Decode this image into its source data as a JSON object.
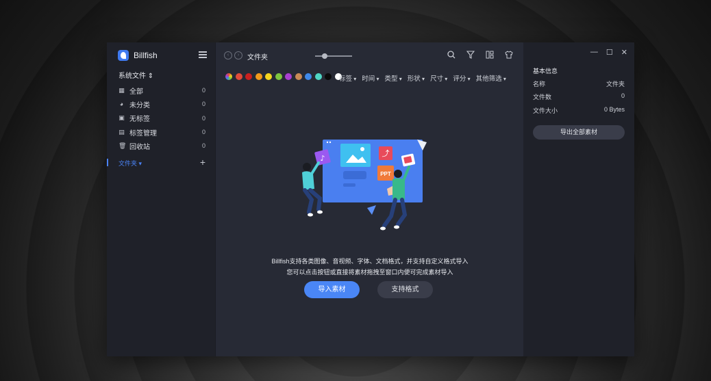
{
  "app": {
    "name": "Billfish"
  },
  "sidebar": {
    "section_title": "系统文件 ⇕",
    "items": [
      {
        "label": "全部",
        "count": "0"
      },
      {
        "label": "未分类",
        "count": "0"
      },
      {
        "label": "无标签",
        "count": "0"
      },
      {
        "label": "标签管理",
        "count": "0"
      },
      {
        "label": "回收站",
        "count": "0"
      }
    ],
    "folders_label": "文件夹 ▾",
    "add_symbol": "+"
  },
  "main": {
    "title": "文件夹",
    "zoom_level": 0.25,
    "color_filters": [
      "#e04b3a",
      "#c9201f",
      "#f39a1c",
      "#f5d51f",
      "#7ec53f",
      "#a93fd0",
      "#c98a55",
      "#3f89e9",
      "#4fd6c4",
      "#0b0b0b",
      "#ffffff"
    ],
    "filters": [
      "标签",
      "时间",
      "类型",
      "形状",
      "尺寸",
      "评分",
      "其他筛选"
    ],
    "illustration_label": "PPT",
    "description_line1": "Billfish支持各类图像、音视频、字体、文档格式，并支持自定义格式导入",
    "description_line2": "您可以点击按钮或直接将素材拖拽至窗口内便可完成素材导入",
    "import_button": "导入素材",
    "formats_button": "支持格式"
  },
  "panel": {
    "title": "基本信息",
    "rows": [
      {
        "label": "名称",
        "value": "文件夹"
      },
      {
        "label": "文件数",
        "value": "0"
      },
      {
        "label": "文件大小",
        "value": "0 Bytes"
      }
    ],
    "export_button": "导出全部素材"
  },
  "colors": {
    "accent": "#4a86f5",
    "sidebar_bg": "#1f2129",
    "main_bg": "#272a35"
  }
}
